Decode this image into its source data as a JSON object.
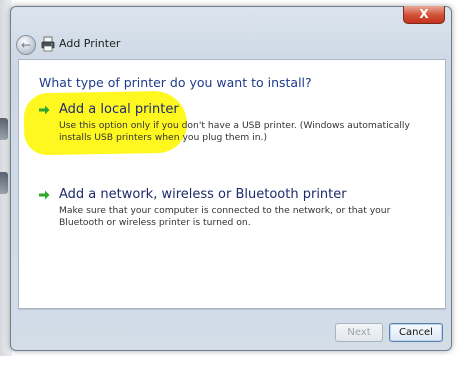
{
  "window": {
    "title": "Add Printer",
    "close_glyph": "X"
  },
  "page": {
    "question": "What type of printer do you want to install?",
    "options": [
      {
        "title": "Add a local printer",
        "description": "Use this option only if you don't have a USB printer. (Windows automatically installs USB printers when you plug them in.)",
        "highlighted": true
      },
      {
        "title": "Add a network, wireless or Bluetooth printer",
        "description": "Make sure that your computer is connected to the network, or that your Bluetooth or wireless printer is turned on.",
        "highlighted": false
      }
    ]
  },
  "buttons": {
    "next_label": "Next",
    "next_enabled": false,
    "cancel_label": "Cancel"
  },
  "icons": {
    "back": "back-arrow-icon",
    "printer": "printer-icon",
    "option_arrow": "green-arrow-icon"
  },
  "colors": {
    "heading_blue": "#1e3c8c",
    "highlight_yellow": "#fff820",
    "arrow_green": "#2da82d"
  }
}
